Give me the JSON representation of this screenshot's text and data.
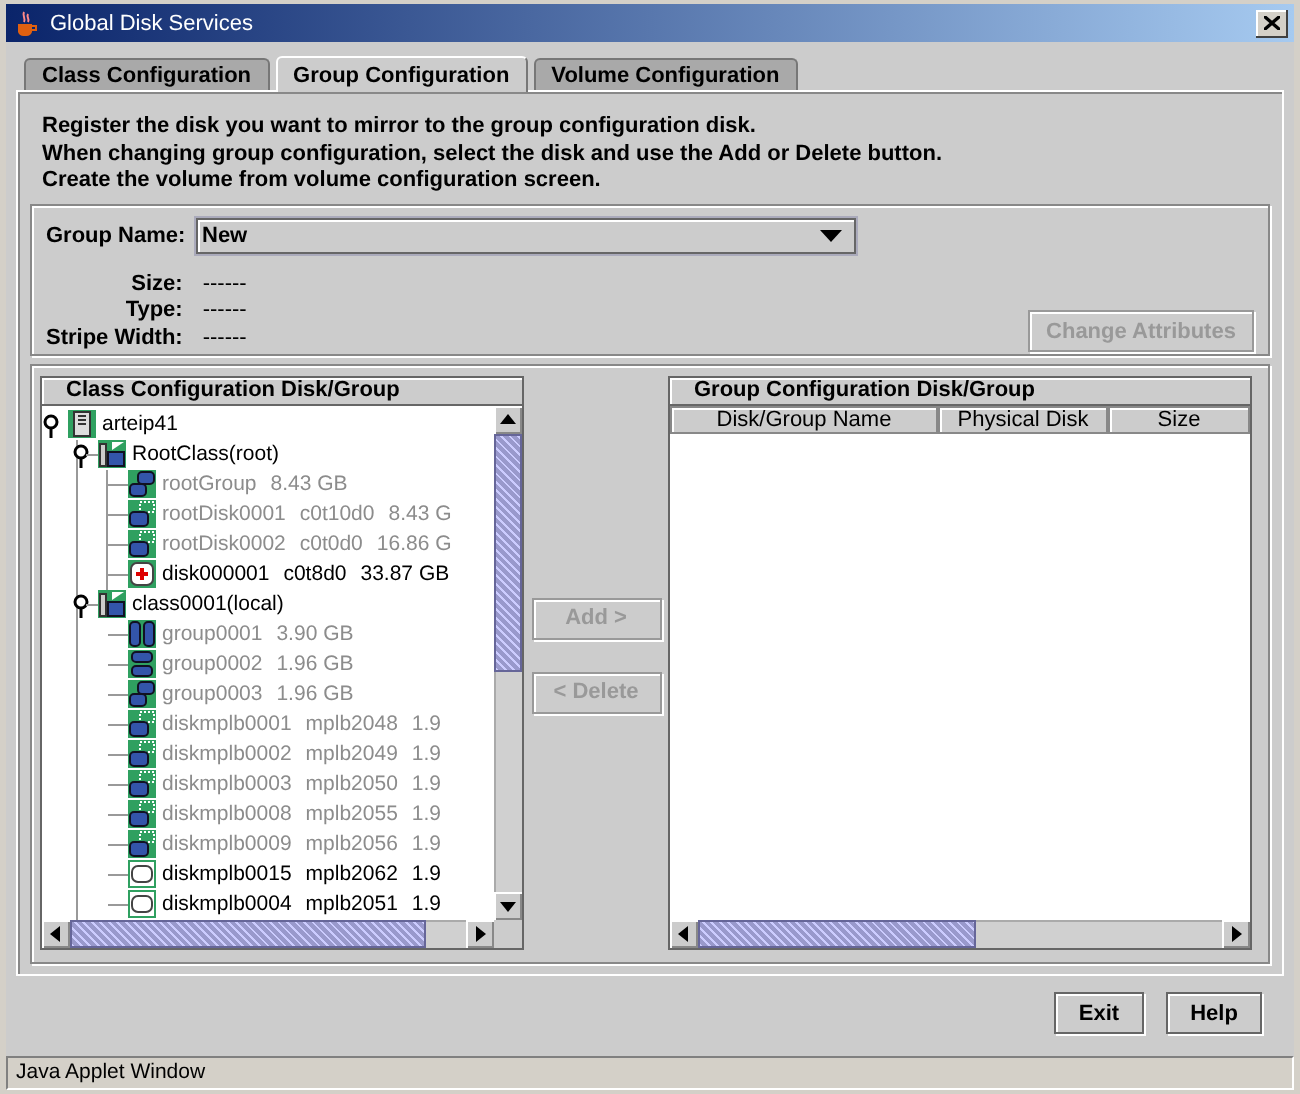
{
  "window": {
    "title": "Global Disk Services"
  },
  "tabs": [
    {
      "label": "Class Configuration",
      "selected": false
    },
    {
      "label": "Group Configuration",
      "selected": true
    },
    {
      "label": "Volume Configuration",
      "selected": false
    }
  ],
  "instructions": [
    "Register the disk you want to mirror to the group configuration disk.",
    "When changing group configuration, select the disk and use the Add or Delete button.",
    "Create the volume from volume configuration screen."
  ],
  "group_name": {
    "label": "Group Name:",
    "value": "New"
  },
  "properties": [
    {
      "label": "Size:",
      "value": "------"
    },
    {
      "label": "Type:",
      "value": "------"
    },
    {
      "label": "Stripe Width:",
      "value": "------"
    }
  ],
  "change_attributes_button": {
    "label": "Change Attributes",
    "disabled": true
  },
  "class_tree": {
    "title": "Class Configuration Disk/Group",
    "items": [
      {
        "kind": "server",
        "texts": [
          "arteip41"
        ],
        "disabled": false,
        "expanded": true,
        "children": [
          {
            "kind": "class",
            "texts": [
              "RootClass(root)"
            ],
            "disabled": false,
            "expanded": true,
            "children": [
              {
                "kind": "mirror-group",
                "texts": [
                  "rootGroup",
                  "8.43 GB"
                ],
                "disabled": true
              },
              {
                "kind": "group-disk",
                "texts": [
                  "rootDisk0001",
                  "c0t10d0",
                  "8.43 G"
                ],
                "disabled": true
              },
              {
                "kind": "group-disk",
                "texts": [
                  "rootDisk0002",
                  "c0t0d0",
                  "16.86 G"
                ],
                "disabled": true
              },
              {
                "kind": "spare-disk",
                "texts": [
                  "disk000001",
                  "c0t8d0",
                  "33.87 GB"
                ],
                "disabled": false
              }
            ]
          },
          {
            "kind": "class",
            "texts": [
              "class0001(local)"
            ],
            "disabled": false,
            "expanded": true,
            "children": [
              {
                "kind": "stripe-group",
                "texts": [
                  "group0001",
                  "3.90 GB"
                ],
                "disabled": true
              },
              {
                "kind": "concat-group",
                "texts": [
                  "group0002",
                  "1.96 GB"
                ],
                "disabled": true
              },
              {
                "kind": "mirror-group",
                "texts": [
                  "group0003",
                  "1.96 GB"
                ],
                "disabled": true
              },
              {
                "kind": "group-disk",
                "texts": [
                  "diskmplb0001",
                  "mplb2048",
                  "1.9"
                ],
                "disabled": true
              },
              {
                "kind": "group-disk",
                "texts": [
                  "diskmplb0002",
                  "mplb2049",
                  "1.9"
                ],
                "disabled": true
              },
              {
                "kind": "group-disk",
                "texts": [
                  "diskmplb0003",
                  "mplb2050",
                  "1.9"
                ],
                "disabled": true
              },
              {
                "kind": "group-disk",
                "texts": [
                  "diskmplb0008",
                  "mplb2055",
                  "1.9"
                ],
                "disabled": true
              },
              {
                "kind": "group-disk",
                "texts": [
                  "diskmplb0009",
                  "mplb2056",
                  "1.9"
                ],
                "disabled": true
              },
              {
                "kind": "free-disk",
                "texts": [
                  "diskmplb0015",
                  "mplb2062",
                  "1.9"
                ],
                "disabled": false
              },
              {
                "kind": "free-disk",
                "texts": [
                  "diskmplb0004",
                  "mplb2051",
                  "1.9"
                ],
                "disabled": false
              }
            ]
          }
        ]
      }
    ]
  },
  "move_buttons": [
    {
      "label": "Add >",
      "disabled": true
    },
    {
      "label": "< Delete",
      "disabled": true
    }
  ],
  "group_table": {
    "title": "Group Configuration Disk/Group",
    "columns": [
      "Disk/Group Name",
      "Physical Disk",
      "Size"
    ]
  },
  "buttons": [
    {
      "label": "Exit",
      "disabled": false
    },
    {
      "label": "Help",
      "disabled": false
    }
  ],
  "status_bar": "Java Applet Window"
}
